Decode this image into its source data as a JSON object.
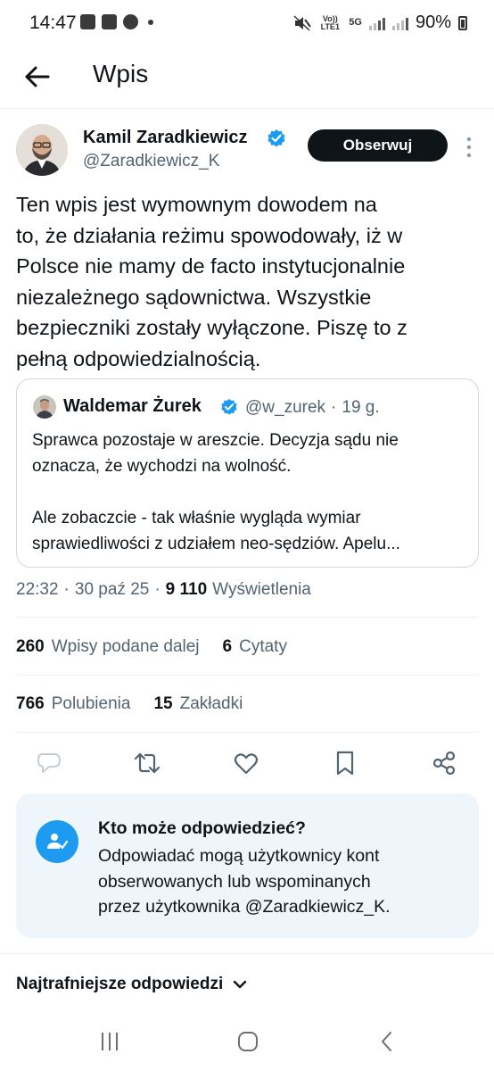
{
  "status_bar": {
    "time": "14:47",
    "battery": "90%",
    "network": "5G",
    "volte": "Vo)) LTE1",
    "icons": [
      "image-icon",
      "m-app-icon",
      "messenger-icon",
      "dot-icon",
      "mute-icon",
      "signal-icon",
      "battery-icon"
    ]
  },
  "header": {
    "title": "Wpis",
    "back_icon": "arrow-left-icon"
  },
  "author": {
    "name": "Kamil Zaradkiewicz",
    "handle": "@Zaradkiewicz_K",
    "follow_label": "Obserwuj",
    "verified_color": "#1d9bf0"
  },
  "tweet": {
    "lines": [
      "Ten wpis jest wymownym dowodem na",
      "to, że działania reżimu spowodowały, iż w",
      "Polsce nie mamy de facto instytucjonalnie",
      "niezależnego sądownictwa. Wszystkie",
      "bezpieczniki zostały wyłączone. Piszę to z",
      "pełną odpowiedzialnością."
    ]
  },
  "quote": {
    "name": "Waldemar Żurek",
    "handle": "@w_zurek",
    "separator": "·",
    "age": "19 g.",
    "lines": [
      "Sprawca pozostaje w areszcie. Decyzja sądu nie",
      "oznacza, że wychodzi na wolność.",
      "",
      "Ale zobaczcie - tak właśnie wygląda wymiar",
      "sprawiedliwości z udziałem neo-sędziów. Apelu..."
    ]
  },
  "timestamp": {
    "time": "22:32",
    "sep1": "·",
    "date": "30 paź 25",
    "sep2": "·",
    "views": "9 110",
    "views_label": "Wyświetlenia"
  },
  "stats": {
    "reposts": "260",
    "reposts_label": "Wpisy podane dalej",
    "quotes": "6",
    "quotes_label": "Cytaty",
    "likes": "766",
    "likes_label": "Polubienia",
    "bookmarks": "15",
    "bookmarks_label": "Zakładki"
  },
  "actions": [
    "reply-icon",
    "repost-icon",
    "like-icon",
    "bookmark-icon",
    "share-icon"
  ],
  "reply_info": {
    "title": "Kto może odpowiedzieć?",
    "lines": [
      "Odpowiadać mogą użytkownicy kont",
      "obserwowanych lub wspominanych",
      "przez użytkownika @Zaradkiewicz_K."
    ],
    "accent": "#1d9bf0",
    "background": "#eef6fc"
  },
  "replies_sort": {
    "label": "Najtrafniejsze odpowiedzi"
  },
  "nav_bar": [
    "recents-icon",
    "home-icon",
    "back-icon"
  ]
}
